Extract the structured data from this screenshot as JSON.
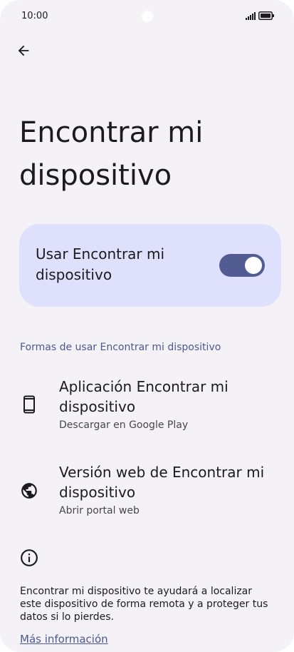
{
  "status_bar": {
    "time": "10:00"
  },
  "page": {
    "title": "Encontrar mi dispositivo"
  },
  "main_toggle": {
    "label": "Usar Encontrar mi dispositivo",
    "enabled": true
  },
  "section": {
    "header": "Formas de usar Encontrar mi dispositivo"
  },
  "items": [
    {
      "title": "Aplicación Encontrar mi dispositivo",
      "subtitle": "Descargar en Google Play",
      "icon": "phone-icon"
    },
    {
      "title": "Versión web de Encontrar mi dispositivo",
      "subtitle": "Abrir portal web",
      "icon": "globe-icon"
    }
  ],
  "info": {
    "icon": "info-icon",
    "text": "Encontrar mi dispositivo te ayudará a localizar este dispositivo de forma remota y a proteger tus datos si lo pierdes.",
    "link": "Más información"
  },
  "colors": {
    "background": "#f4f2f6",
    "card": "#dfe0fb",
    "switch_track": "#525b92",
    "accent_text": "#4d5891"
  }
}
